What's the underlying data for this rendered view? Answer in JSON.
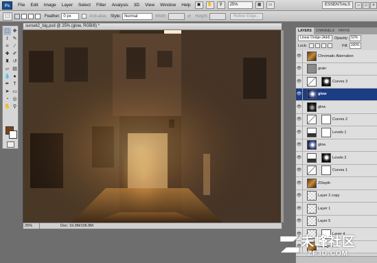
{
  "menubar": {
    "logo": "Ps",
    "items": [
      "File",
      "Edit",
      "Image",
      "Layer",
      "Select",
      "Filter",
      "Analysis",
      "3D",
      "View",
      "Window",
      "Help"
    ],
    "zoom": "25%",
    "workspace": "ESSENTIALS",
    "window_buttons": [
      "–",
      "□",
      "×"
    ]
  },
  "options": {
    "feather_label": "Feather:",
    "feather_value": "0 px",
    "antialias_label": "Anti-alias",
    "style_label": "Style:",
    "style_value": "Normal",
    "width_label": "Width:",
    "height_label": "Height:",
    "refine_label": "Refine Edge..."
  },
  "document": {
    "title": "sunset2_big.psd @ 25% (glow, RGB/8) *",
    "status_zoom": "25%",
    "status_doc": "Doc: 19.3M/106.8M"
  },
  "colors": {
    "foreground": "#7a4318",
    "background": "#ffffff",
    "selection": "#1c3c83"
  },
  "layers_panel": {
    "tabs": [
      "LAYERS",
      "CHANNELS",
      "PATHS"
    ],
    "blend_mode": "Linear Dodge (Add)",
    "opacity_label": "Opacity:",
    "opacity_value": "52%",
    "lock_label": "Lock:",
    "fill_label": "Fill:",
    "fill_value": "100%",
    "layers": [
      {
        "name": "Chromatic Aberration",
        "thumb": "photo",
        "selected": false
      },
      {
        "name": "grain",
        "thumb": "gray",
        "selected": false
      },
      {
        "name": "Curves 3",
        "thumb": "curves",
        "mask": "dark",
        "selected": false
      },
      {
        "name": "glow",
        "thumb": "glow",
        "selected": true
      },
      {
        "name": "glow",
        "thumb": "glow-dark",
        "selected": false
      },
      {
        "name": "Curves 2",
        "thumb": "curves",
        "mask": "white",
        "selected": false
      },
      {
        "name": "Levels 1",
        "thumb": "levels",
        "mask": "white",
        "selected": false
      },
      {
        "name": "glow",
        "thumb": "glow",
        "selected": false
      },
      {
        "name": "Levels 2",
        "thumb": "levels",
        "mask": "dark",
        "selected": false
      },
      {
        "name": "Curves 1",
        "thumb": "curves",
        "mask": "white",
        "selected": false
      },
      {
        "name": "ZDepth",
        "thumb": "photo",
        "selected": false
      },
      {
        "name": "Layer 2 copy",
        "thumb": "checker",
        "selected": false
      },
      {
        "name": "Layer 1",
        "thumb": "checker",
        "selected": false
      },
      {
        "name": "Layer 5",
        "thumb": "checker",
        "selected": false
      },
      {
        "name": "Layer 4",
        "thumb": "checker",
        "mask": "white",
        "selected": false
      },
      {
        "name": "Background",
        "thumb": "photo",
        "selected": false
      }
    ]
  },
  "watermark": {
    "text": "未峰社区",
    "sub": "ZF3D.COM"
  }
}
